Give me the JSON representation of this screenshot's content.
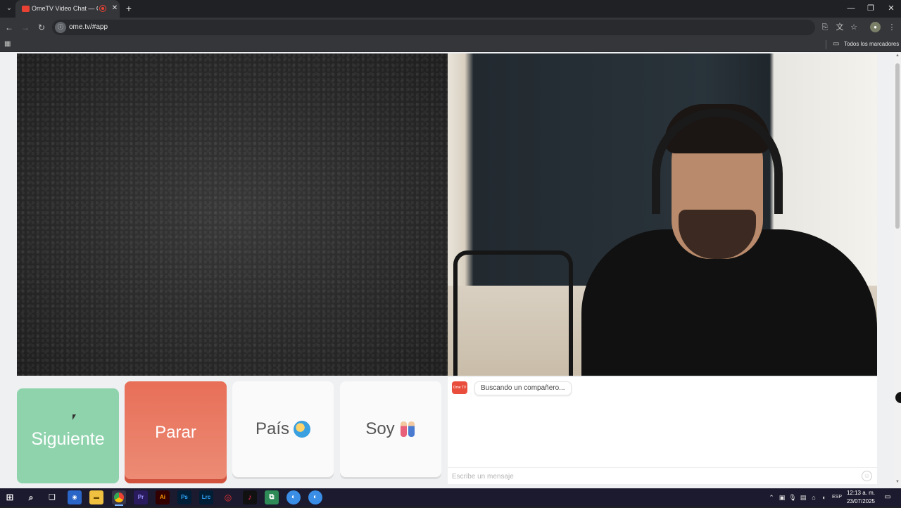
{
  "browser": {
    "tab_title": "OmeTV Video Chat — Ome",
    "tab_close": "✕",
    "new_tab": "+",
    "url": "ome.tv/#app",
    "bookmarks_folder": "Todos los marcadores",
    "window": {
      "minimize": "—",
      "maximize": "❐",
      "close": "✕"
    }
  },
  "controls": {
    "next_label": "Siguiente",
    "stop_label": "Parar",
    "country_label": "País",
    "gender_label": "Soy"
  },
  "chat": {
    "status_message": "Buscando un compañero...",
    "logo_text": "Ome TV",
    "input_placeholder": "Escribe un mensaje"
  },
  "taskbar": {
    "language": "ESP",
    "time": "12:13 a. m.",
    "date": "23/07/2025",
    "apps": [
      {
        "name": "Premiere Pro",
        "label": "Pr",
        "color": "#2a1a5e",
        "text_color": "#9999ff"
      },
      {
        "name": "Illustrator",
        "label": "Ai",
        "color": "#330000",
        "text_color": "#ff9a00"
      },
      {
        "name": "Photoshop",
        "label": "Ps",
        "color": "#001e36",
        "text_color": "#31a8ff"
      },
      {
        "name": "Lightroom Classic",
        "label": "Lrc",
        "color": "#001e36",
        "text_color": "#31a8ff"
      }
    ]
  },
  "colors": {
    "next_button": "#8fd3ad",
    "stop_button": "#e86f58",
    "page_background": "#eef0f1",
    "browser_chrome": "#202124"
  }
}
